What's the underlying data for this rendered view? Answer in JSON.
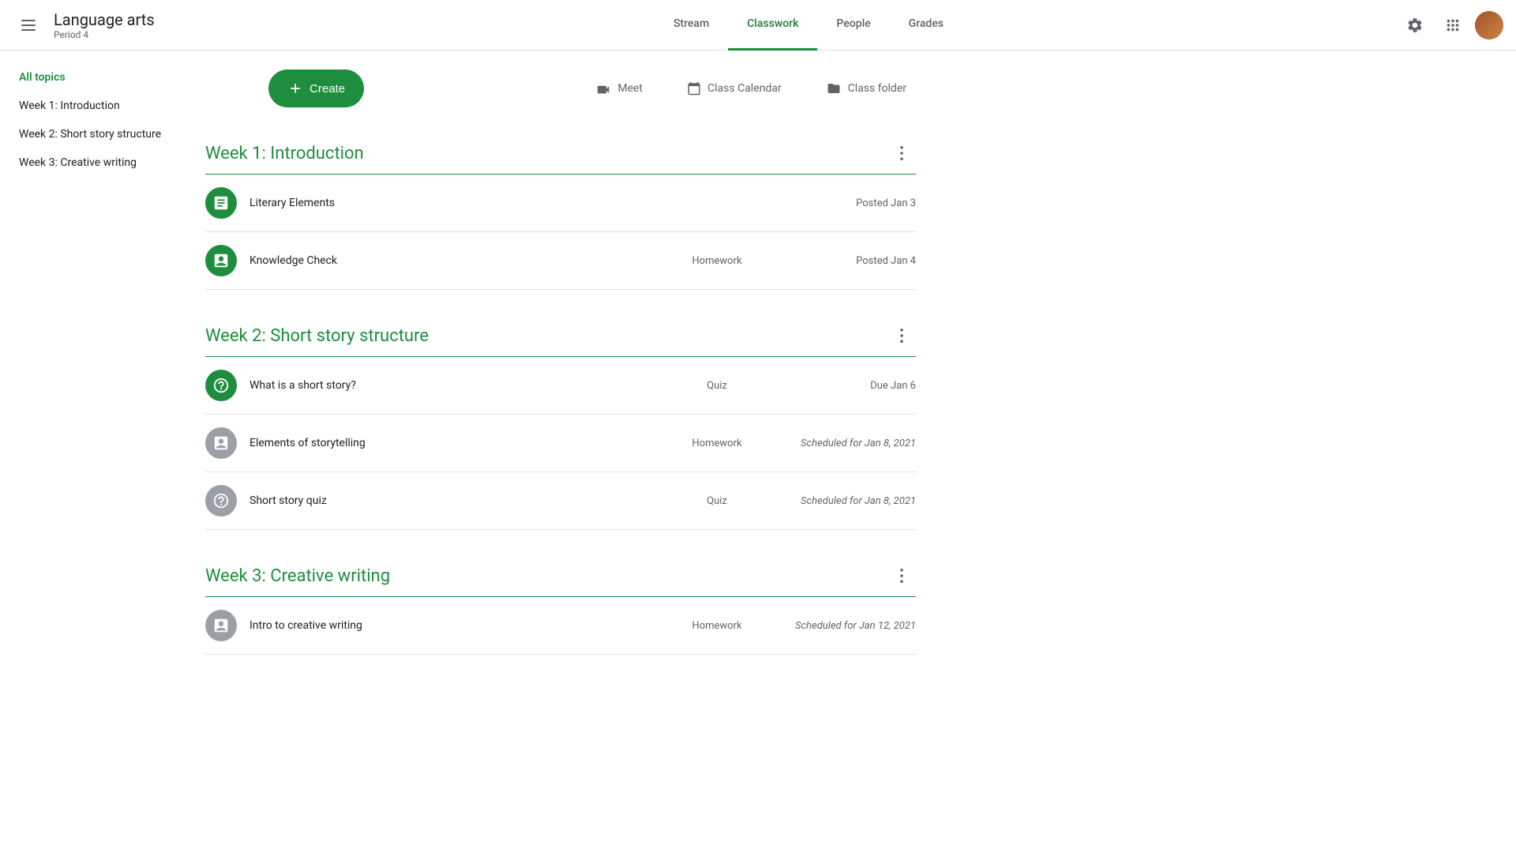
{
  "header": {
    "menu_label": "☰",
    "app_title": "Language arts",
    "app_subtitle": "Period 4",
    "nav_tabs": [
      {
        "label": "Stream",
        "id": "stream",
        "active": false
      },
      {
        "label": "Classwork",
        "id": "classwork",
        "active": true
      },
      {
        "label": "People",
        "id": "people",
        "active": false
      },
      {
        "label": "Grades",
        "id": "grades",
        "active": false
      }
    ],
    "settings_icon": "⚙",
    "apps_icon": "⋮⋮⋮",
    "toolbar": {
      "create_label": "Create",
      "create_icon": "+",
      "meet_label": "Meet",
      "calendar_label": "Class Calendar",
      "folder_label": "Class folder"
    }
  },
  "sidebar": {
    "items": [
      {
        "label": "All topics",
        "active": true
      },
      {
        "label": "Week 1: Introduction",
        "active": false
      },
      {
        "label": "Week 2: Short story structure",
        "active": false
      },
      {
        "label": "Week 3: Creative writing",
        "active": false
      }
    ]
  },
  "topics": [
    {
      "title": "Week 1: Introduction",
      "assignments": [
        {
          "name": "Literary Elements",
          "type": "",
          "date": "Posted Jan 3",
          "icon_type": "material",
          "scheduled": false
        },
        {
          "name": "Knowledge Check",
          "type": "Homework",
          "date": "Posted Jan 4",
          "icon_type": "assignment",
          "scheduled": false
        }
      ]
    },
    {
      "title": "Week 2: Short story structure",
      "assignments": [
        {
          "name": "What is a short story?",
          "type": "Quiz",
          "date": "Due Jan 6",
          "icon_type": "quiz-green",
          "scheduled": false
        },
        {
          "name": "Elements of storytelling",
          "type": "Homework",
          "date": "Scheduled for Jan 8, 2021",
          "icon_type": "assignment-gray",
          "scheduled": true
        },
        {
          "name": "Short story quiz",
          "type": "Quiz",
          "date": "Scheduled for Jan 8, 2021",
          "icon_type": "quiz-gray",
          "scheduled": true
        }
      ]
    },
    {
      "title": "Week 3: Creative writing",
      "assignments": [
        {
          "name": "Intro to creative writing",
          "type": "Homework",
          "date": "Scheduled for Jan 12, 2021",
          "icon_type": "assignment-gray",
          "scheduled": true
        }
      ]
    }
  ],
  "icons": {
    "material": "📋",
    "assignment": "📋",
    "quiz_green": "❓",
    "quiz_gray": "❓",
    "assignment_gray": "📋"
  }
}
